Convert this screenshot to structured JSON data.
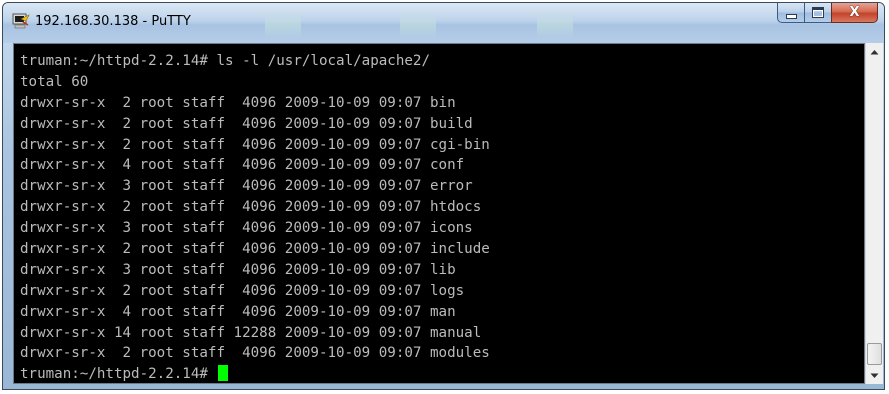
{
  "window": {
    "title": "192.168.30.138 - PuTTY",
    "close_glyph": "X",
    "icons": {
      "app": "putty-terminal-icon",
      "minimize": "minimize-icon",
      "maximize": "maximize-icon",
      "close": "close-icon",
      "scroll_up": "scroll-up-arrow-icon",
      "scroll_down": "scroll-down-arrow-icon"
    }
  },
  "terminal": {
    "background": "#000000",
    "foreground": "#bbbbbb",
    "cursor_color": "#00ff00",
    "command_line": "truman:~/httpd-2.2.14# ls -l /usr/local/apache2/",
    "total_line": "total 60",
    "entries": [
      "drwxr-sr-x  2 root staff  4096 2009-10-09 09:07 bin",
      "drwxr-sr-x  2 root staff  4096 2009-10-09 09:07 build",
      "drwxr-sr-x  2 root staff  4096 2009-10-09 09:07 cgi-bin",
      "drwxr-sr-x  4 root staff  4096 2009-10-09 09:07 conf",
      "drwxr-sr-x  3 root staff  4096 2009-10-09 09:07 error",
      "drwxr-sr-x  2 root staff  4096 2009-10-09 09:07 htdocs",
      "drwxr-sr-x  3 root staff  4096 2009-10-09 09:07 icons",
      "drwxr-sr-x  2 root staff  4096 2009-10-09 09:07 include",
      "drwxr-sr-x  3 root staff  4096 2009-10-09 09:07 lib",
      "drwxr-sr-x  2 root staff  4096 2009-10-09 09:07 logs",
      "drwxr-sr-x  4 root staff  4096 2009-10-09 09:07 man",
      "drwxr-sr-x 14 root staff 12288 2009-10-09 09:07 manual",
      "drwxr-sr-x  2 root staff  4096 2009-10-09 09:07 modules"
    ],
    "prompt": "truman:~/httpd-2.2.14# "
  }
}
